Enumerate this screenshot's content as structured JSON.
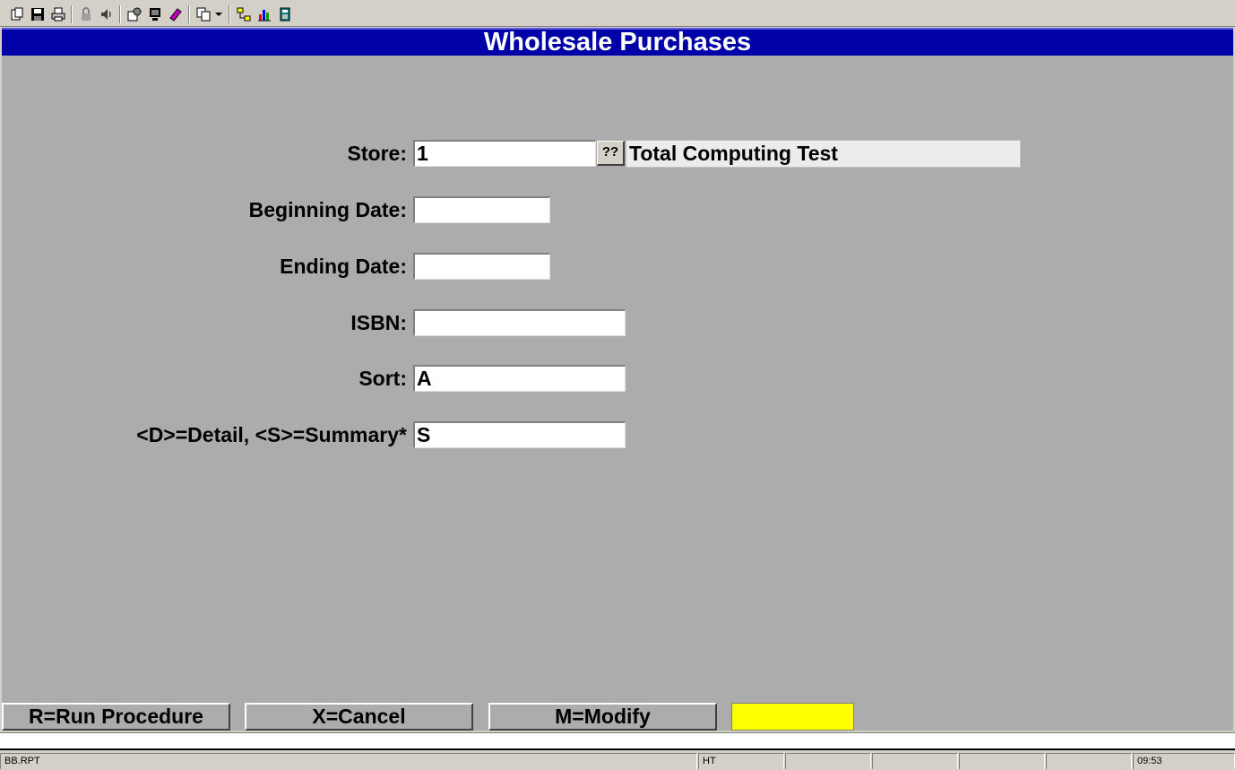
{
  "toolbar": {
    "icons": [
      "new-document-icon",
      "save-icon",
      "print-icon",
      "lock-icon",
      "speaker-icon",
      "settings-icon",
      "monitor-icon",
      "book-icon",
      "copy-icon",
      "dropdown-arrow-icon",
      "network-icon",
      "bar-chart-icon",
      "calculator-icon"
    ]
  },
  "window": {
    "title": "Wholesale Purchases"
  },
  "form": {
    "store": {
      "label": "Store:",
      "value": "1",
      "lookup_label": "??",
      "name": "Total Computing Test"
    },
    "beginning_date": {
      "label": "Beginning Date:",
      "value": ""
    },
    "ending_date": {
      "label": "Ending Date:",
      "value": ""
    },
    "isbn": {
      "label": "ISBN:",
      "value": ""
    },
    "sort": {
      "label": "Sort:",
      "value": "A"
    },
    "detail_summary": {
      "label": "<D>=Detail, <S>=Summary*",
      "value": "S"
    }
  },
  "actions": {
    "run_label": "R=Run Procedure",
    "cancel_label": "X=Cancel",
    "modify_label": "M=Modify"
  },
  "status": {
    "program": "BB.RPT",
    "user": "HT",
    "time": "09:53"
  },
  "colors": {
    "title_bg": "#0000a8",
    "form_bg": "#acacac",
    "highlight": "#ffff00"
  }
}
